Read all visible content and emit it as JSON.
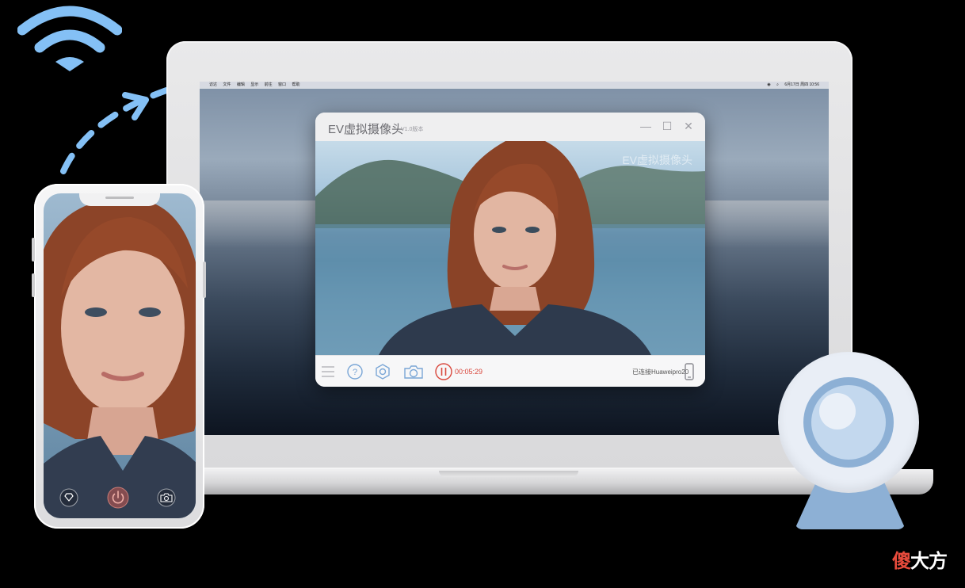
{
  "menubar": {
    "left_items": [
      "访达",
      "文件",
      "编辑",
      "显示",
      "前往",
      "窗口",
      "帮助"
    ],
    "status_right": "6月17日 周四 10:56"
  },
  "app": {
    "title": "EV虚拟摄像头",
    "version": "V1.0版本",
    "watermark": "EV虚拟摄像头",
    "record_time": "00:05:29",
    "connection_status": "已连接Huaweipro20"
  },
  "controls": [
    "menu-icon",
    "help-icon",
    "settings-hex-icon",
    "camera-icon",
    "pause-record-icon",
    "phone-icon"
  ],
  "phone_controls": [
    "beauty-diamond-icon",
    "power-icon",
    "switch-camera-icon"
  ],
  "brand": {
    "char1": "傻",
    "rest": "大方"
  },
  "colors": {
    "accent_blue": "#8db0d5",
    "wifi_blue": "#84c0f5",
    "record_red": "#d9473c"
  }
}
